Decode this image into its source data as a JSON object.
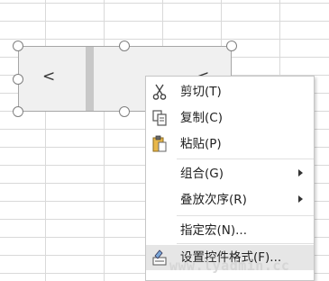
{
  "scrollbar_control": {
    "left_arrow": "<",
    "right_arrow": "<"
  },
  "context_menu": {
    "items": [
      {
        "icon": "scissors-icon",
        "label": "剪切(T)",
        "submenu": false
      },
      {
        "icon": "copy-icon",
        "label": "复制(C)",
        "submenu": false
      },
      {
        "icon": "paste-icon",
        "label": "粘贴(P)",
        "submenu": false
      },
      {
        "icon": "",
        "label": "组合(G)",
        "submenu": true
      },
      {
        "icon": "",
        "label": "叠放次序(R)",
        "submenu": true
      },
      {
        "icon": "",
        "label": "指定宏(N)...",
        "submenu": false
      },
      {
        "icon": "format-control-icon",
        "label": "设置控件格式(F)...",
        "submenu": false,
        "highlighted": true
      }
    ]
  },
  "watermark": "www.lyadmin.cc",
  "colors": {
    "menu_highlight": "#e6e6e6",
    "control_bg": "#f0f0f0",
    "grid": "#d9d9d9"
  }
}
